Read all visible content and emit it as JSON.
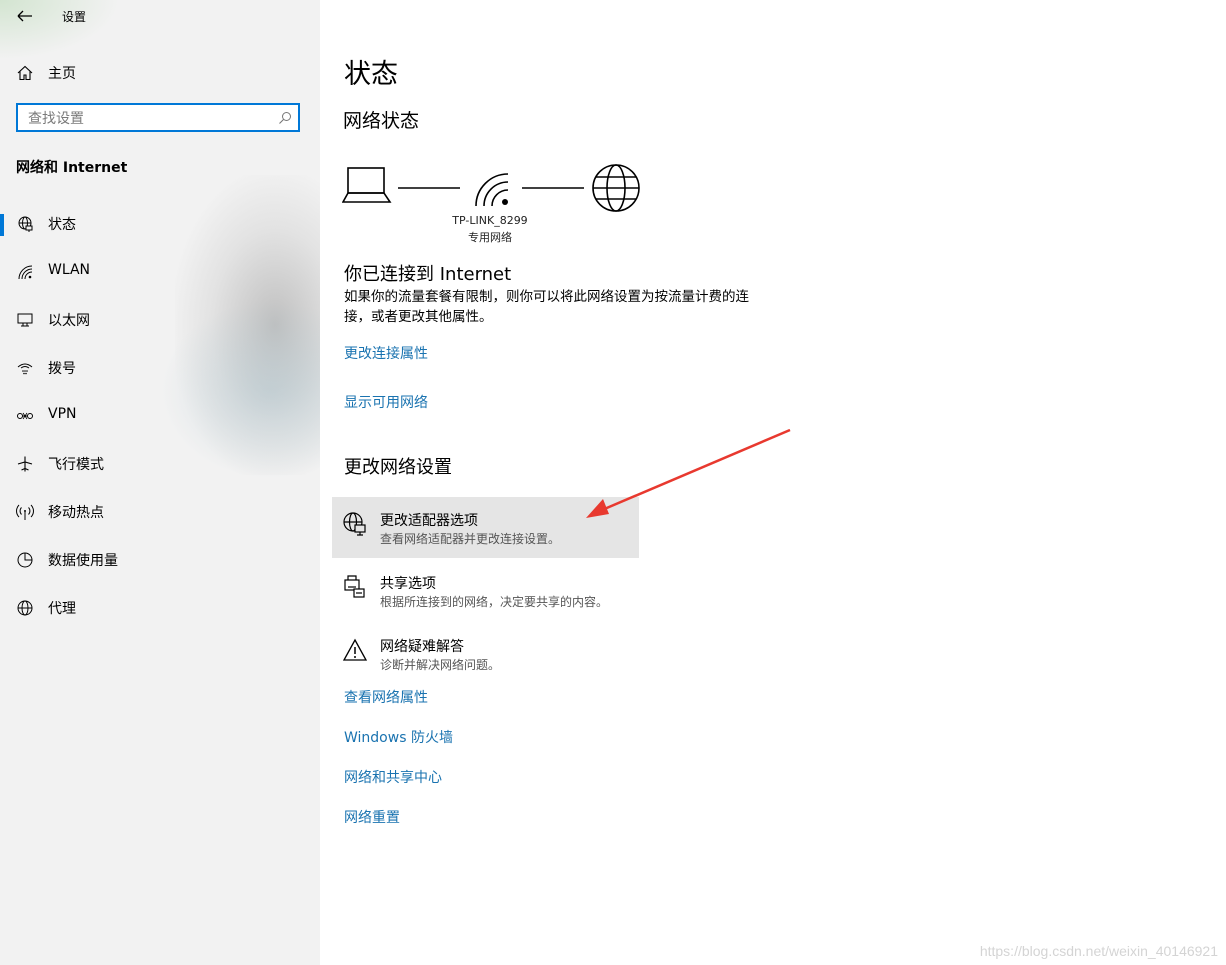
{
  "window": {
    "title": "设置"
  },
  "sidebar": {
    "home_label": "主页",
    "search_placeholder": "查找设置",
    "section_title": "网络和 Internet",
    "items": [
      {
        "label": "状态",
        "icon": "status-globe-icon",
        "active": true
      },
      {
        "label": "WLAN",
        "icon": "wifi-icon"
      },
      {
        "label": "以太网",
        "icon": "ethernet-icon"
      },
      {
        "label": "拨号",
        "icon": "dialup-icon"
      },
      {
        "label": "VPN",
        "icon": "vpn-icon"
      },
      {
        "label": "飞行模式",
        "icon": "airplane-icon"
      },
      {
        "label": "移动热点",
        "icon": "hotspot-icon"
      },
      {
        "label": "数据使用量",
        "icon": "data-usage-icon"
      },
      {
        "label": "代理",
        "icon": "proxy-globe-icon"
      }
    ]
  },
  "main": {
    "title": "状态",
    "network_status_heading": "网络状态",
    "network": {
      "name": "TP-LINK_8299",
      "type": "专用网络"
    },
    "connected_heading": "你已连接到 Internet",
    "connected_desc": "如果你的流量套餐有限制，则你可以将此网络设置为按流量计费的连接，或者更改其他属性。",
    "links_top": [
      "更改连接属性",
      "显示可用网络"
    ],
    "change_settings_heading": "更改网络设置",
    "options": [
      {
        "title": "更改适配器选项",
        "desc": "查看网络适配器并更改连接设置。",
        "icon": "adapter-icon",
        "highlighted": true
      },
      {
        "title": "共享选项",
        "desc": "根据所连接到的网络，决定要共享的内容。",
        "icon": "sharing-icon"
      },
      {
        "title": "网络疑难解答",
        "desc": "诊断并解决网络问题。",
        "icon": "warning-icon"
      }
    ],
    "links_bottom": [
      "查看网络属性",
      "Windows 防火墙",
      "网络和共享中心",
      "网络重置"
    ]
  },
  "annotation": {
    "arrow_color": "#e8392f"
  },
  "watermark": "https://blog.csdn.net/weixin_40146921",
  "colors": {
    "accent": "#0078d7",
    "link": "#1a73b0",
    "sidebar_bg": "#f2f2f2",
    "highlight_bg": "#e5e5e5"
  }
}
